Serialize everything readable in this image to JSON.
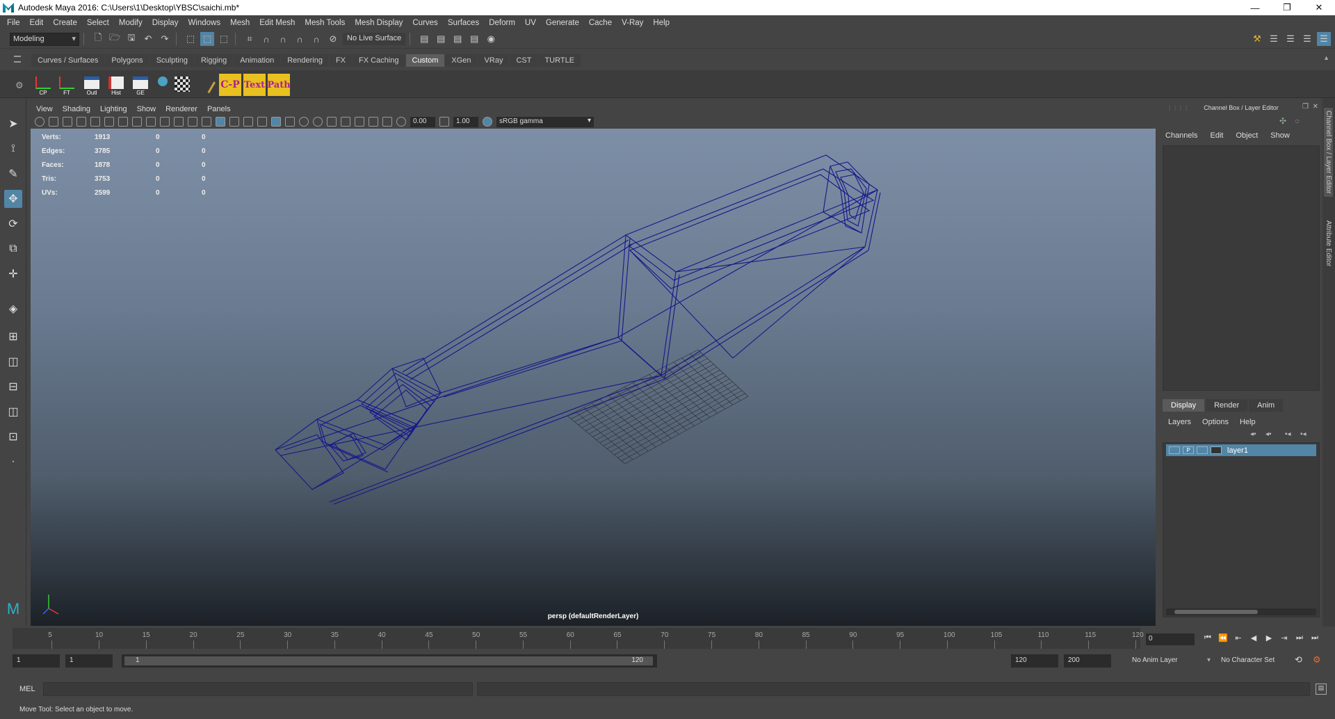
{
  "window": {
    "title": "Autodesk Maya 2016: C:\\Users\\1\\Desktop\\YBSC\\saichi.mb*",
    "min": "—",
    "max": "❐",
    "close": "✕"
  },
  "menus": [
    "File",
    "Edit",
    "Create",
    "Select",
    "Modify",
    "Display",
    "Windows",
    "Mesh",
    "Edit Mesh",
    "Mesh Tools",
    "Mesh Display",
    "Curves",
    "Surfaces",
    "Deform",
    "UV",
    "Generate",
    "Cache",
    "V-Ray",
    "Help"
  ],
  "status": {
    "mode": "Modeling",
    "live_surface": "No Live Surface"
  },
  "shelf_tabs": [
    {
      "label": "Curves / Surfaces",
      "active": false
    },
    {
      "label": "Polygons",
      "active": false
    },
    {
      "label": "Sculpting",
      "active": false
    },
    {
      "label": "Rigging",
      "active": false
    },
    {
      "label": "Animation",
      "active": false
    },
    {
      "label": "Rendering",
      "active": false
    },
    {
      "label": "FX",
      "active": false
    },
    {
      "label": "FX Caching",
      "active": false
    },
    {
      "label": "Custom",
      "active": true
    },
    {
      "label": "XGen",
      "active": false
    },
    {
      "label": "VRay",
      "active": false
    },
    {
      "label": "CST",
      "active": false
    },
    {
      "label": "TURTLE",
      "active": false
    }
  ],
  "shelf_items": [
    "CP",
    "FT",
    "Outl",
    "Hist",
    "GE",
    "C-P",
    "Text",
    "Path"
  ],
  "panel_menu": [
    "View",
    "Shading",
    "Lighting",
    "Show",
    "Renderer",
    "Panels"
  ],
  "panel_toolbar": {
    "exposure": "0.00",
    "gamma": "1.00",
    "color_space": "sRGB gamma"
  },
  "hud": [
    {
      "label": "Verts:",
      "v1": "1913",
      "v2": "0",
      "v3": "0"
    },
    {
      "label": "Edges:",
      "v1": "3785",
      "v2": "0",
      "v3": "0"
    },
    {
      "label": "Faces:",
      "v1": "1878",
      "v2": "0",
      "v3": "0"
    },
    {
      "label": "Tris:",
      "v1": "3753",
      "v2": "0",
      "v3": "0"
    },
    {
      "label": "UVs:",
      "v1": "2599",
      "v2": "0",
      "v3": "0"
    }
  ],
  "camera_label": "persp (defaultRenderLayer)",
  "right_panel": {
    "title": "Channel Box / Layer Editor",
    "menu": [
      "Channels",
      "Edit",
      "Object",
      "Show"
    ],
    "layer_tabs": [
      {
        "label": "Display",
        "active": true
      },
      {
        "label": "Render",
        "active": false
      },
      {
        "label": "Anim",
        "active": false
      }
    ],
    "layer_menu": [
      "Layers",
      "Options",
      "Help"
    ],
    "layer": {
      "v": "",
      "p": "P",
      "name": "layer1"
    }
  },
  "side_tabs": [
    "Channel Box / Layer Editor",
    "Attribute Editor"
  ],
  "timeline": {
    "ticks": [
      "5",
      "10",
      "15",
      "20",
      "25",
      "30",
      "35",
      "40",
      "45",
      "50",
      "55",
      "60",
      "65",
      "70",
      "75",
      "80",
      "85",
      "90",
      "95",
      "100",
      "105",
      "110",
      "115",
      "120"
    ],
    "current_frame": "0"
  },
  "range": {
    "start": "1",
    "anim_start": "1",
    "slider_start": "1",
    "slider_end": "120",
    "end": "120",
    "anim_end": "200",
    "anim_layer": "No Anim Layer",
    "char_set": "No Character Set"
  },
  "cmd": {
    "mel": "MEL"
  },
  "help_line": "Move Tool: Select an object to move.",
  "colors": {
    "accent": "#5285a6",
    "wire": "#1a1a78"
  }
}
